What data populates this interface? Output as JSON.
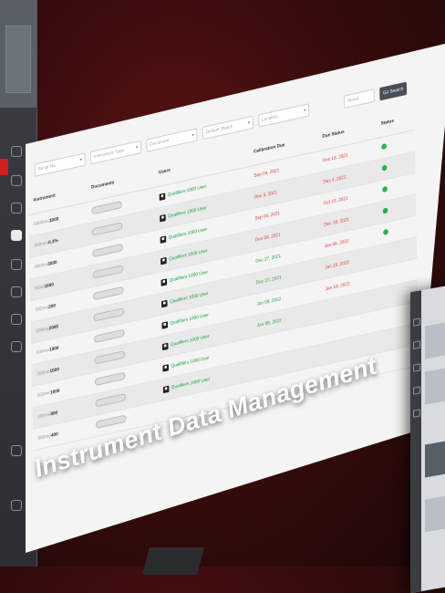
{
  "overlay_title": "Instrument Data Management",
  "toolbar": {
    "filters": [
      "Serial No.",
      "Instrument Type",
      "Document",
      "Default Status",
      "Location",
      "Reset"
    ],
    "search_button": "Go Search"
  },
  "table": {
    "columns": [
      "Instrument",
      "Documents",
      "Users",
      "Calibration Due",
      "Due Status",
      "Status"
    ],
    "rows": [
      {
        "instrument_prefix": "0000me",
        "instrument_id": "3000",
        "users": "Qualifiers 1000 User",
        "due1": "Sep 04, 2021",
        "due2": "Dec 18, 2021",
        "due1_color": "#e33b3b",
        "due2_color": "#e33b3b",
        "status": true
      },
      {
        "instrument_prefix": "000mm",
        "instrument_id": "0.3%",
        "users": "Qualifiers 1000 User",
        "due1": "Dec 3, 2021",
        "due2": "Dec 4, 2021",
        "due1_color": "#e33b3b",
        "due2_color": "#e33b3b",
        "status": true
      },
      {
        "instrument_prefix": "0000m",
        "instrument_id": "3000",
        "users": "Qualifiers 1000 User",
        "due1": "Sep 04, 2021",
        "due2": "Oct 15, 2021",
        "due1_color": "#e33b3b",
        "due2_color": "#e33b3b",
        "status": true
      },
      {
        "instrument_prefix": "00ml",
        "instrument_id": "1000",
        "users": "Qualifiers 1000 User",
        "due1": "Dec 08, 2021",
        "due2": "Dec 18, 2021",
        "due1_color": "#e33b3b",
        "due2_color": "#e33b3b",
        "status": true
      },
      {
        "instrument_prefix": "000me",
        "instrument_id": "200",
        "users": "Qualifiers 1000 User",
        "due1": "Dec 27, 2021",
        "due2": "Jan 06, 2022",
        "due1_color": "#2a9d45",
        "due2_color": "#e33b3b",
        "status": true
      },
      {
        "instrument_prefix": "000me",
        "instrument_id": "2000",
        "users": "Qualifiers 1000 User",
        "due1": "Dec 27, 2021",
        "due2": "Jan 15, 2022",
        "due1_color": "#2a9d45",
        "due2_color": "#e33b3b",
        "status": false
      },
      {
        "instrument_prefix": "000me",
        "instrument_id": "1000",
        "users": "Qualifiers 1000 User",
        "due1": "Jan 08, 2022",
        "due2": "Jan 18, 2022",
        "due1_color": "#2a9d45",
        "due2_color": "#e33b3b",
        "status": false
      },
      {
        "instrument_prefix": "000me",
        "instrument_id": "1000",
        "users": "Qualifiers 1000 User",
        "due1": "Jan 08, 2022",
        "due2": "",
        "due1_color": "#2a9d45",
        "due2_color": "#e33b3b",
        "status": false
      },
      {
        "instrument_prefix": "000me",
        "instrument_id": "1000",
        "users": "Qualifiers 1000 User",
        "due1": "",
        "due2": "",
        "due1_color": "#2a9d45",
        "due2_color": "#e33b3b",
        "status": false
      },
      {
        "instrument_prefix": "000me",
        "instrument_id": "800",
        "users": "Qualifiers 1000 User",
        "due1": "",
        "due2": "",
        "due1_color": "#2a9d45",
        "due2_color": "#e33b3b",
        "status": false
      },
      {
        "instrument_prefix": "000me",
        "instrument_id": "400",
        "users": "",
        "due1": "",
        "due2": "",
        "due1_color": "#2a9d45",
        "due2_color": "#e33b3b",
        "status": false
      }
    ]
  },
  "sidebar_icons": [
    "home-icon",
    "folder-icon",
    "grid-icon",
    "document-icon",
    "chart-icon",
    "users-icon",
    "settings-icon",
    "help-icon",
    "export-icon"
  ]
}
